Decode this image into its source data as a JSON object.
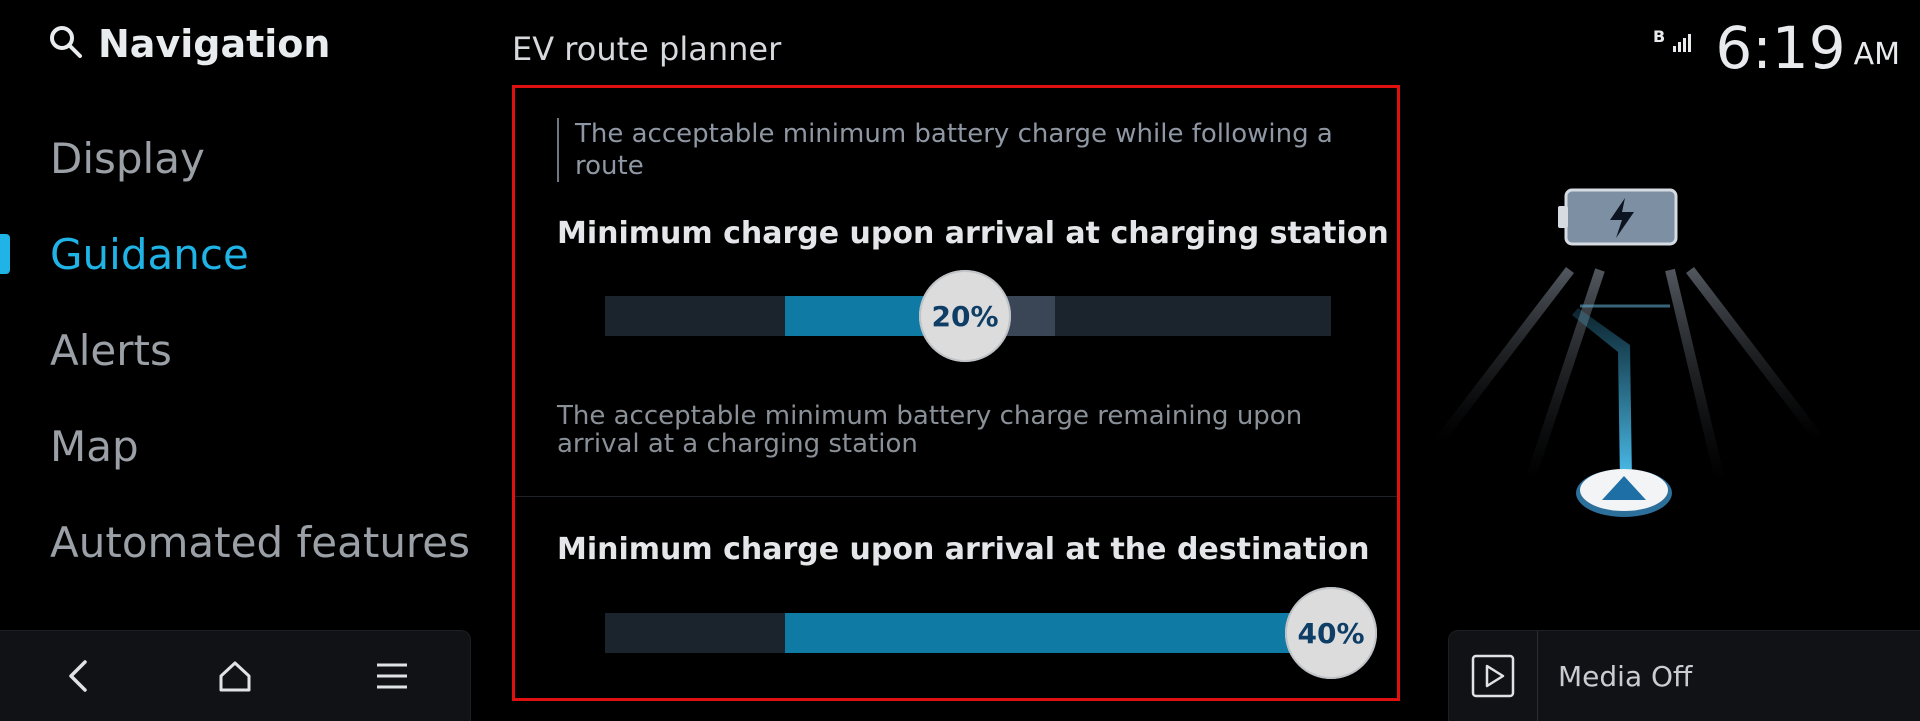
{
  "nav": {
    "title": "Navigation",
    "items": [
      {
        "label": "Display",
        "active": false
      },
      {
        "label": "Guidance",
        "active": true
      },
      {
        "label": "Alerts",
        "active": false
      },
      {
        "label": "Map",
        "active": false
      },
      {
        "label": "Automated features",
        "active": false
      }
    ]
  },
  "section_title": "EV route planner",
  "panel": {
    "top_description": "The acceptable minimum battery charge while following a route",
    "charging_station": {
      "title": "Minimum charge upon arrival at charging station",
      "value_label": "20%",
      "value": 0.2,
      "description": "The acceptable minimum battery charge remaining upon arrival at a charging station"
    },
    "destination": {
      "title": "Minimum charge upon arrival at the destination",
      "value_label": "40%",
      "value": 0.4
    }
  },
  "status": {
    "time": "6:19",
    "ampm": "AM",
    "bt_icon": "bluetooth-signal-icon"
  },
  "media": {
    "label": "Media Off"
  },
  "colors": {
    "accent": "#1fb3e6",
    "fill": "#0f7ba4",
    "highlight_border": "#e01010"
  }
}
